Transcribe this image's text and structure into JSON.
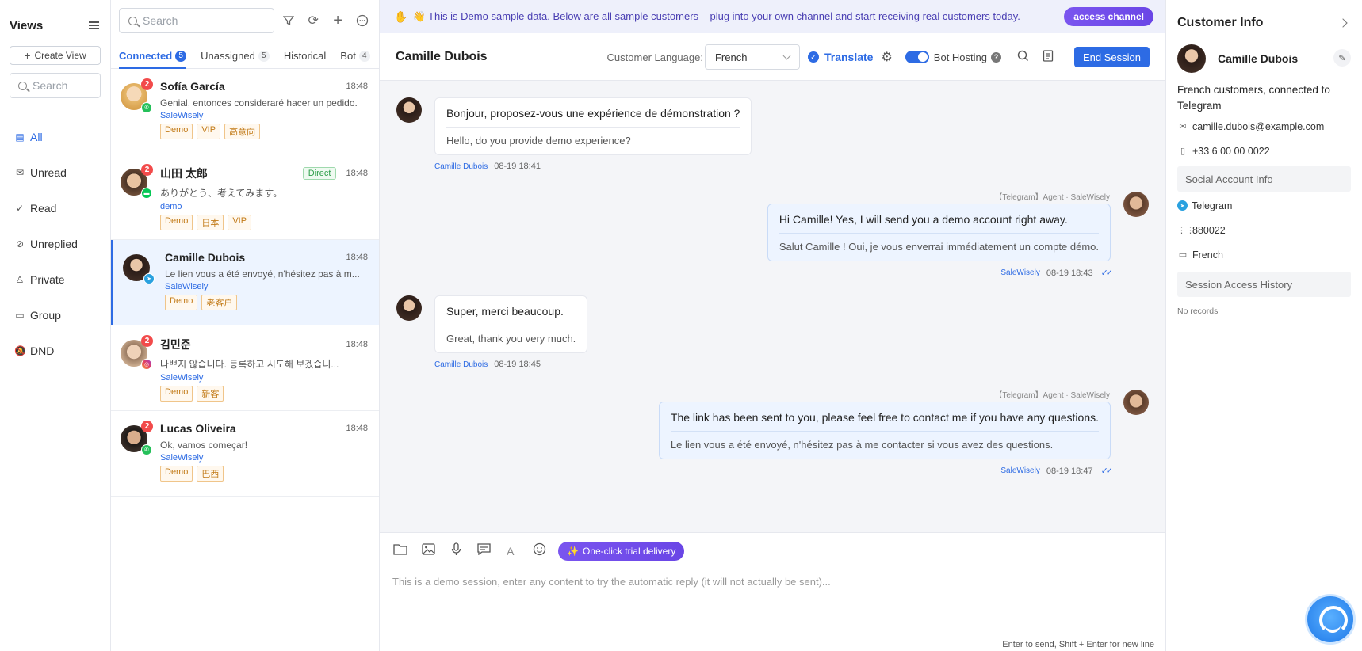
{
  "views": {
    "title": "Views",
    "create_label": "Create View",
    "search_placeholder": "Search",
    "items": [
      {
        "label": "All",
        "icon": "all-icon"
      },
      {
        "label": "Unread",
        "icon": "mail-icon"
      },
      {
        "label": "Read",
        "icon": "check-icon"
      },
      {
        "label": "Unreplied",
        "icon": "eye-off-icon"
      },
      {
        "label": "Private",
        "icon": "user-icon"
      },
      {
        "label": "Group",
        "icon": "chat-icon"
      },
      {
        "label": "DND",
        "icon": "bell-off-icon"
      }
    ],
    "active": "All"
  },
  "conversations": {
    "search_placeholder": "Search",
    "tabs": [
      {
        "label": "Connected",
        "count": "5"
      },
      {
        "label": "Unassigned",
        "count": "5"
      },
      {
        "label": "Historical",
        "count": ""
      },
      {
        "label": "Bot",
        "count": "4"
      }
    ],
    "items": [
      {
        "name": "Sofía García",
        "time": "18:48",
        "unread": "2",
        "channel": "whatsapp",
        "message": "Genial, entonces consideraré hacer un pedido.",
        "agent": "SaleWisely",
        "tags": [
          "Demo",
          "VIP",
          "高意向"
        ],
        "direct": ""
      },
      {
        "name": "山田 太郎",
        "time": "18:48",
        "unread": "2",
        "channel": "line",
        "message": "ありがとう、考えてみます。",
        "agent": "demo",
        "tags": [
          "Demo",
          "日本",
          "VIP"
        ],
        "direct": "Direct"
      },
      {
        "name": "Camille Dubois",
        "time": "18:48",
        "unread": "",
        "channel": "telegram",
        "message": "Le lien vous a été envoyé, n'hésitez pas à m...",
        "agent": "SaleWisely",
        "tags": [
          "Demo",
          "老客户"
        ],
        "direct": ""
      },
      {
        "name": "김민준",
        "time": "18:48",
        "unread": "2",
        "channel": "instagram",
        "message": "나쁘지 않습니다. 등록하고 시도해 보겠습니...",
        "agent": "SaleWisely",
        "tags": [
          "Demo",
          "新客"
        ],
        "direct": ""
      },
      {
        "name": "Lucas Oliveira",
        "time": "18:48",
        "unread": "2",
        "channel": "whatsapp",
        "message": "Ok, vamos começar!",
        "agent": "SaleWisely",
        "tags": [
          "Demo",
          "巴西"
        ],
        "direct": ""
      }
    ]
  },
  "banner": {
    "text": "👋 This is Demo sample data. Below are all sample customers – plug into your own channel and start receiving real customers today.",
    "button": "access channel"
  },
  "chat": {
    "title": "Camille Dubois",
    "language_label": "Customer Language:",
    "language_value": "French",
    "translate_label": "Translate",
    "bot_hosting_label": "Bot Hosting",
    "end_session_label": "End Session",
    "messages": [
      {
        "direction": "in",
        "original": "Bonjour, proposez-vous une expérience de démonstration ?",
        "translation": "Hello, do you provide demo experience?",
        "sender": "Camille Dubois",
        "time": "08-19 18:41"
      },
      {
        "direction": "out",
        "source": "【Telegram】Agent · SaleWisely",
        "original": "Hi Camille! Yes, I will send you a demo account right away.",
        "translation": "Salut Camille ! Oui, je vous enverrai immédiatement un compte démo.",
        "sender": "SaleWisely",
        "time": "08-19 18:43"
      },
      {
        "direction": "in",
        "original": "Super, merci beaucoup.",
        "translation": "Great, thank you very much.",
        "sender": "Camille Dubois",
        "time": "08-19 18:45"
      },
      {
        "direction": "out",
        "source": "【Telegram】Agent · SaleWisely",
        "original": "The link has been sent to you, please feel free to contact me if you have any questions.",
        "translation": "Le lien vous a été envoyé, n'hésitez pas à me contacter si vous avez des questions.",
        "sender": "SaleWisely",
        "time": "08-19 18:47"
      }
    ],
    "composer": {
      "trial_button": "One-click trial delivery",
      "placeholder": "This is a demo session, enter any content to try the automatic reply (it will not actually be sent)...",
      "hint": "Enter to send, Shift + Enter for new line"
    }
  },
  "customer_info": {
    "title": "Customer Info",
    "name": "Camille Dubois",
    "description": "French customers, connected to Telegram",
    "email": "camille.dubois@example.com",
    "phone": "+33 6 00 00 0022",
    "social_section": "Social Account Info",
    "social_channel": "Telegram",
    "social_id": "880022",
    "social_language": "French",
    "history_section": "Session Access History",
    "history_empty": "No records"
  },
  "colors": {
    "accent": "#2d6be4",
    "purple": "#6a46e6",
    "unread": "#f24b4b",
    "whatsapp": "#25c05a",
    "line": "#06c755",
    "telegram": "#2aa1df",
    "instagram": "#e4405f"
  }
}
